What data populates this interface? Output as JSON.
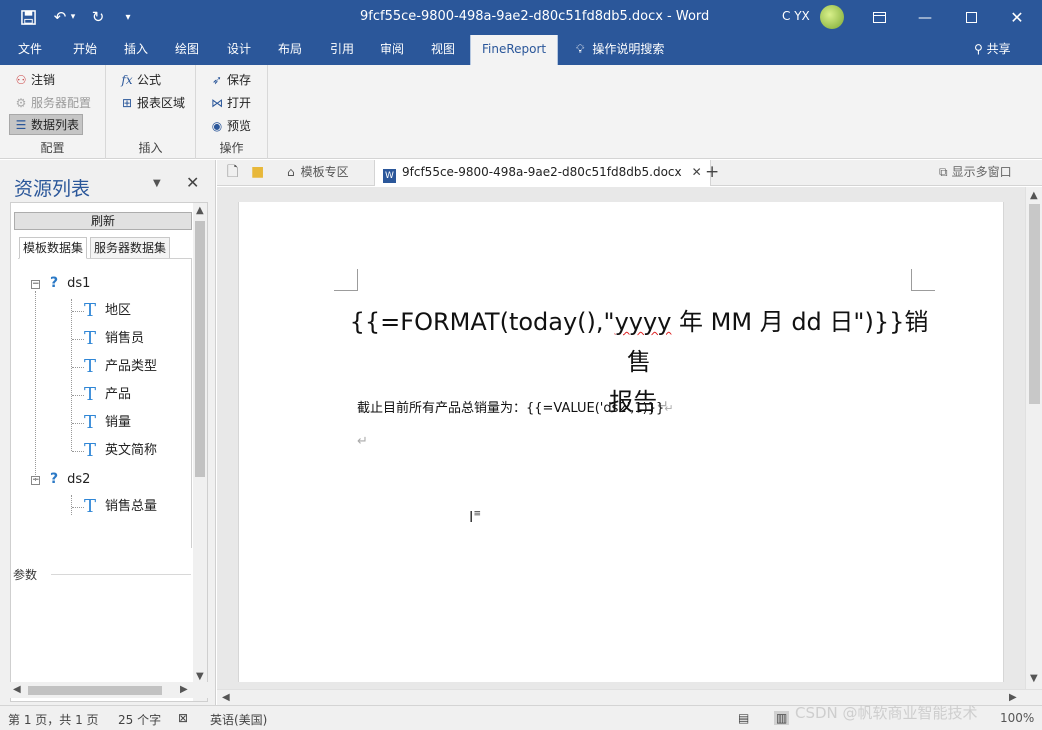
{
  "titlebar": {
    "title": "9fcf55ce-9800-498a-9ae2-d80c51fd8db5.docx  -  Word",
    "user": "C YX",
    "save_icon": "save-icon",
    "undo_icon": "undo-icon",
    "redo_icon": "redo-icon"
  },
  "tabs": [
    {
      "label": "文件"
    },
    {
      "label": "开始"
    },
    {
      "label": "插入"
    },
    {
      "label": "绘图"
    },
    {
      "label": "设计"
    },
    {
      "label": "布局"
    },
    {
      "label": "引用"
    },
    {
      "label": "审阅"
    },
    {
      "label": "视图"
    },
    {
      "label": "FineReport"
    }
  ],
  "tell_me": "操作说明搜索",
  "share": "共享",
  "ribbon": {
    "config": {
      "logout": "注销",
      "server_config": "服务器配置",
      "data_list": "数据列表",
      "label": "配置"
    },
    "insert": {
      "formula": "公式",
      "report_area": "报表区域",
      "label": "插入"
    },
    "operate": {
      "save": "保存",
      "open": "打开",
      "preview": "预览",
      "label": "操作"
    }
  },
  "panel": {
    "title": "资源列表",
    "refresh": "刷新",
    "tabs": [
      "模板数据集",
      "服务器数据集"
    ],
    "datasets": [
      {
        "name": "ds1",
        "fields": [
          "地区",
          "销售员",
          "产品类型",
          "产品",
          "销量",
          "英文简称"
        ]
      },
      {
        "name": "ds2",
        "fields": [
          "销售总量"
        ]
      }
    ],
    "params_label": "参数"
  },
  "doctabs": {
    "template_zone": "模板专区",
    "doc_name": "9fcf55ce-9800-498a-9ae2-d80c51fd8db5.docx",
    "multi_window": "显示多窗口"
  },
  "document": {
    "heading_pre": "{{=FORMAT(today(),\"",
    "heading_squig": "yyyy",
    "heading_post": " 年 MM 月 dd 日\")}}销售",
    "heading_line2": "报告",
    "para": "截止目前所有产品总销量为：{{=VALUE('ds2',1)}}",
    "para_mark": "↵"
  },
  "statusbar": {
    "page": "第 1 页，共 1 页",
    "words": "25 个字",
    "lang": "英语(美国)",
    "zoom": "100%"
  },
  "watermark": "CSDN @帆软商业智能技术"
}
